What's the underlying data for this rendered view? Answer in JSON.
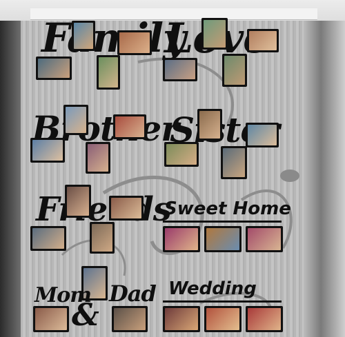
{
  "image": {
    "description_visible_text": true,
    "panel_colors": {
      "wood": "#bebebe",
      "ink": "#0f0f0f"
    }
  },
  "collages": [
    {
      "id": "family",
      "text": "Family"
    },
    {
      "id": "love",
      "text": "Love"
    },
    {
      "id": "brother",
      "text": "Brother"
    },
    {
      "id": "sister",
      "text": "Sister"
    },
    {
      "id": "friends",
      "text": "Friends"
    },
    {
      "id": "sweet-home",
      "text": "Sweet Home"
    },
    {
      "id": "mom-dad",
      "text_left": "Mom",
      "amp": "&",
      "text_right": "Dad"
    },
    {
      "id": "wedding",
      "text": "Wedding"
    }
  ]
}
